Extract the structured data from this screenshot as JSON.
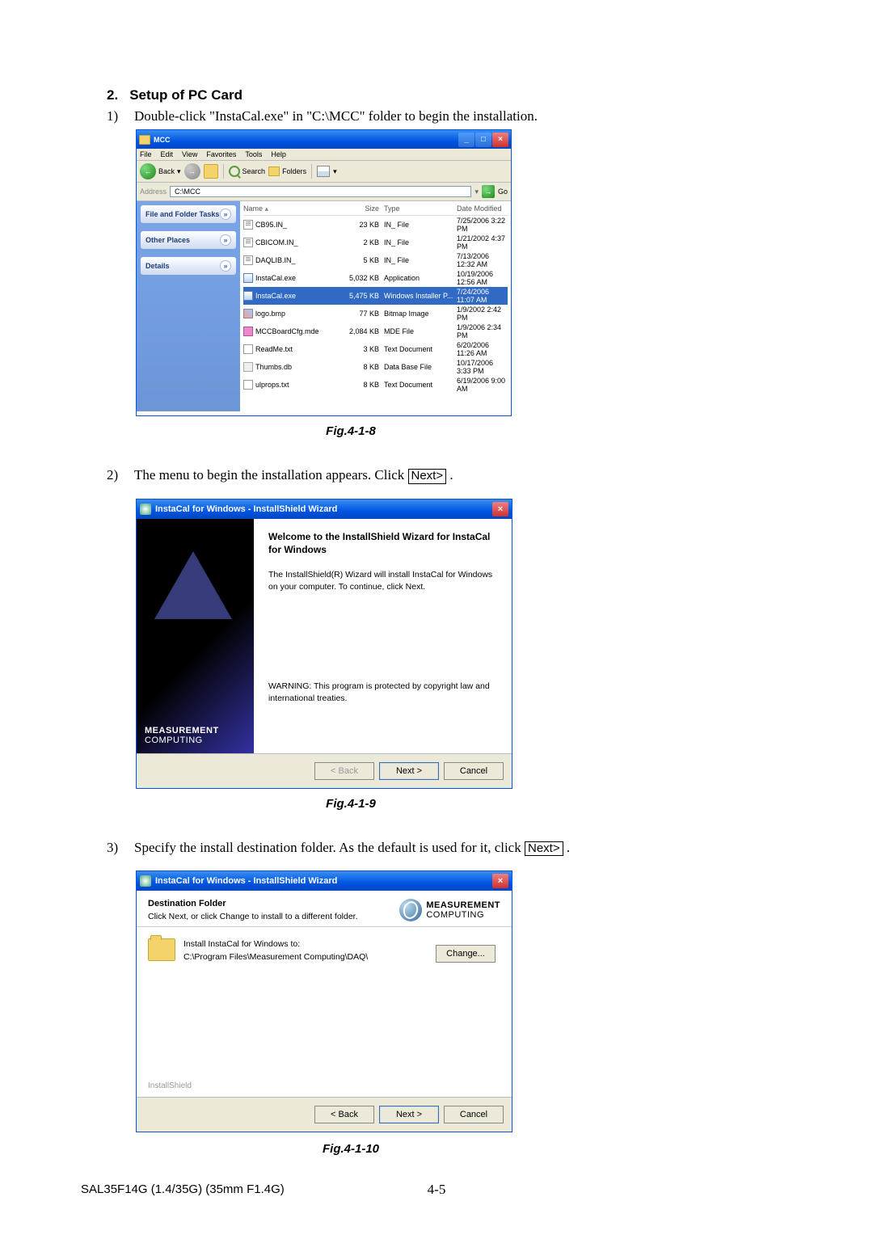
{
  "heading": {
    "num": "2.",
    "text": "Setup of PC Card"
  },
  "steps": {
    "s1": {
      "num": "1)",
      "text_a": "Double-click \"InstaCal.exe\" in \"C:\\MCC\" folder to begin the installation."
    },
    "s2": {
      "num": "2)",
      "text_a": "The menu to begin the installation appears. Click ",
      "btn": "Next>",
      "text_b": " ."
    },
    "s3": {
      "num": "3)",
      "text_a": "Specify the install destination folder. As the default is used for it, click ",
      "btn": "Next>",
      "text_b": " ."
    }
  },
  "captions": {
    "f1": "Fig.4-1-8",
    "f2": "Fig.4-1-9",
    "f3": "Fig.4-1-10"
  },
  "explorer": {
    "title": "MCC",
    "menus": [
      "File",
      "Edit",
      "View",
      "Favorites",
      "Tools",
      "Help"
    ],
    "toolbar": {
      "back": "Back",
      "search": "Search",
      "folders": "Folders"
    },
    "address_label": "Address",
    "address_value": "C:\\MCC",
    "go": "Go",
    "side": {
      "t1": "File and Folder Tasks",
      "t2": "Other Places",
      "t3": "Details"
    },
    "cols": {
      "name": "Name",
      "size": "Size",
      "type": "Type",
      "date": "Date Modified"
    },
    "rows": [
      {
        "n": "CB95.IN_",
        "s": "23 KB",
        "t": "IN_ File",
        "d": "7/25/2006 3:22 PM",
        "ic": "ini"
      },
      {
        "n": "CBICOM.IN_",
        "s": "2 KB",
        "t": "IN_ File",
        "d": "1/21/2002 4:37 PM",
        "ic": "ini"
      },
      {
        "n": "DAQLIB.IN_",
        "s": "5 KB",
        "t": "IN_ File",
        "d": "7/13/2006 12:32 AM",
        "ic": "ini"
      },
      {
        "n": "InstaCal.exe",
        "s": "5,032 KB",
        "t": "Application",
        "d": "10/19/2006 12:56 AM",
        "ic": "exe"
      },
      {
        "n": "InstaCal.exe",
        "s": "5,475 KB",
        "t": "Windows Installer P...",
        "d": "7/24/2006 11:07 AM",
        "ic": "exe",
        "sel": true
      },
      {
        "n": "logo.bmp",
        "s": "77 KB",
        "t": "Bitmap Image",
        "d": "1/9/2002 2:42 PM",
        "ic": "bmp"
      },
      {
        "n": "MCCBoardCfg.mde",
        "s": "2,084 KB",
        "t": "MDE File",
        "d": "1/9/2006 2:34 PM",
        "ic": "mde"
      },
      {
        "n": "ReadMe.txt",
        "s": "3 KB",
        "t": "Text Document",
        "d": "6/20/2006 11:26 AM",
        "ic": "txt"
      },
      {
        "n": "Thumbs.db",
        "s": "8 KB",
        "t": "Data Base File",
        "d": "10/17/2006 3:33 PM",
        "ic": "db"
      },
      {
        "n": "ulprops.txt",
        "s": "8 KB",
        "t": "Text Document",
        "d": "6/19/2006 9:00 AM",
        "ic": "txt"
      }
    ]
  },
  "wizard1": {
    "title": "InstaCal for Windows - InstallShield Wizard",
    "heading": "Welcome to the InstallShield Wizard for InstaCal for Windows",
    "body": "The InstallShield(R) Wizard will install InstaCal for Windows on your computer. To continue, click Next.",
    "warning": "WARNING: This program is protected by copyright law and international treaties.",
    "side_logo1": "MEASUREMENT",
    "side_logo2": "COMPUTING",
    "btn_back": "< Back",
    "btn_next": "Next >",
    "btn_cancel": "Cancel"
  },
  "wizard2": {
    "title": "InstaCal for Windows - InstallShield Wizard",
    "top1": "Destination Folder",
    "top2": "Click Next, or click Change to install to a different folder.",
    "logo1": "MEASUREMENT",
    "logo2": "COMPUTING",
    "line1": "Install InstaCal for Windows to:",
    "line2": "C:\\Program Files\\Measurement Computing\\DAQ\\",
    "change": "Change...",
    "ishield": "InstallShield",
    "btn_back": "< Back",
    "btn_next": "Next >",
    "btn_cancel": "Cancel"
  },
  "footer": "SAL35F14G (1.4/35G) (35mm F1.4G)",
  "pagenum": "4-5"
}
